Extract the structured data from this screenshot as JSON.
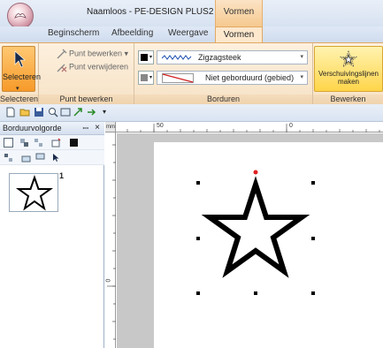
{
  "window": {
    "title": "Naamloos - PE-DESIGN PLUS2",
    "context_tab_group": "Vormen"
  },
  "ribbon_tabs": [
    {
      "label": "Beginscherm"
    },
    {
      "label": "Afbeelding"
    },
    {
      "label": "Weergave"
    },
    {
      "label": "Vormen",
      "active": true
    }
  ],
  "ribbon": {
    "select_group": {
      "button_label": "Selecteren",
      "group_label": "Selecteren"
    },
    "point_group": {
      "edit_point": "Punt bewerken",
      "delete_point": "Punt verwijderen",
      "group_label": "Punt bewerken"
    },
    "embroidery_group": {
      "line_stitch": "Zigzagsteek",
      "region_stitch": "Niet geborduurd (gebied)",
      "group_label": "Borduren"
    },
    "edit_group": {
      "button_line1": "Verschuivingslijnen",
      "button_line2": "maken",
      "group_label": "Bewerken"
    }
  },
  "panel": {
    "title": "Borduurvolgorde",
    "pin": "ꟷ",
    "close": "×",
    "items": [
      {
        "number": "1"
      }
    ]
  },
  "ruler": {
    "top_labels": [
      "50",
      "0"
    ],
    "left_labels": [
      "0"
    ]
  },
  "icons": {
    "app_orb": "app-menu-icon",
    "select": "cursor-arrow-icon",
    "offset": "offset-star-icon"
  },
  "colors": {
    "accent_orange": "#f79a2a",
    "ribbon_bg": "#fdf0de",
    "selection_handle": "#000000",
    "rotate_handle": "#e02020"
  }
}
